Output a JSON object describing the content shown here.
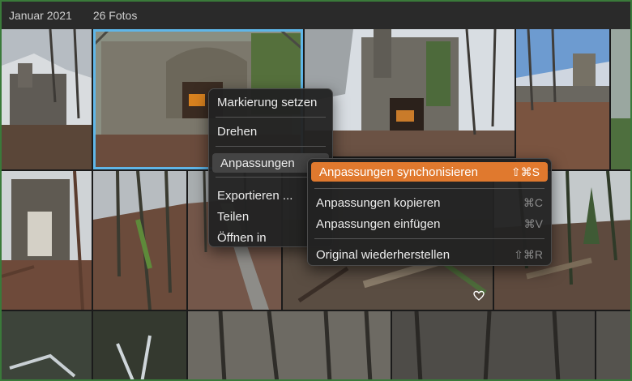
{
  "header": {
    "date": "Januar 2021",
    "count": "26 Fotos"
  },
  "context_menu": {
    "items": [
      {
        "label": "Markierung setzen"
      },
      {
        "label": "Drehen"
      },
      {
        "label": "Anpassungen"
      },
      {
        "label": "Exportieren ..."
      },
      {
        "label": "Teilen"
      },
      {
        "label": "Öffnen in"
      }
    ]
  },
  "submenu": {
    "items": [
      {
        "label": "Anpassungen synchonisieren",
        "shortcut": "⇧⌘S"
      },
      {
        "label": "Anpassungen kopieren",
        "shortcut": "⌘C"
      },
      {
        "label": "Anpassungen einfügen",
        "shortcut": "⌘V"
      },
      {
        "label": "Original wiederherstellen",
        "shortcut": "⇧⌘R"
      }
    ]
  },
  "colors": {
    "accent": "#e0792e",
    "selection": "#5fb6e8"
  },
  "icons": [
    "heart-icon"
  ]
}
